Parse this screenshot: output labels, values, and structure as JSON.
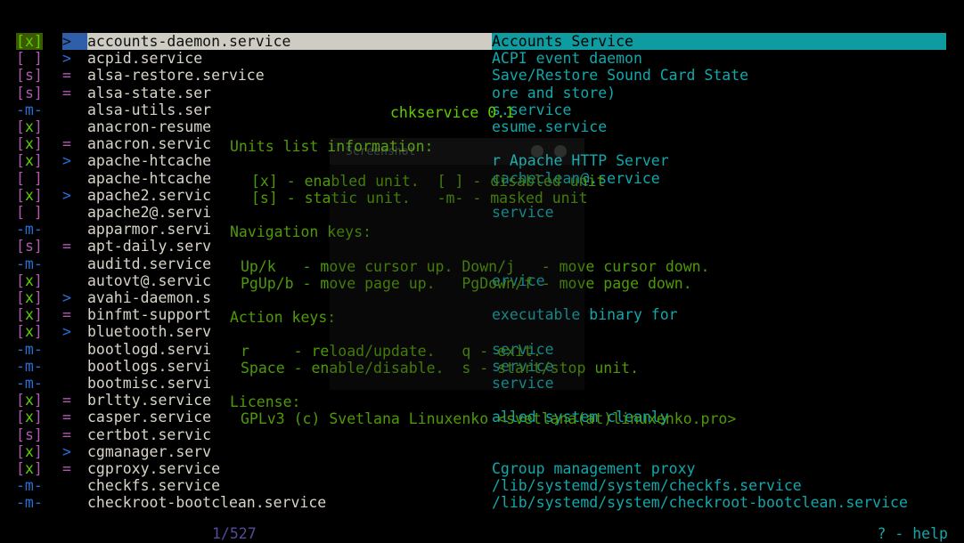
{
  "app": {
    "name": "chkservice",
    "version_line": "chkservice 0.1"
  },
  "colors": {
    "background": "#000000",
    "enabled": "#5fcc00",
    "disabled": "#b05ab0",
    "static": "#b05ab0",
    "masked": "#2a6fd6",
    "unit_name": "#d9d4c8",
    "description": "#11a8ab",
    "help_text": "#4e9a06",
    "selection_name_bg": "#cfcdc3",
    "selection_desc_bg": "#0e9ca0",
    "selection_link_bg": "#2f5fa8",
    "position_counter": "#5a4a9a"
  },
  "legend": {
    "enabled": "[x]",
    "disabled": "[ ]",
    "static": "[s]",
    "masked": "-m-",
    "link_wants": ">",
    "link_requires": "="
  },
  "help_panel": {
    "version": "chkservice 0.1",
    "section_units_title": "Units list information:",
    "units_line_1": "[x] - enabled unit.  [ ] - disabled unit",
    "units_line_2": "[s] - static unit.   -m- - masked unit",
    "section_nav_title": "Navigation keys:",
    "nav_line_1": "Up/k   - move cursor up. Down/j   - move cursor down.",
    "nav_line_2": "PgUp/b - move page up.   PgDown/f - move page down.",
    "section_action_title": "Action keys:",
    "action_line_1": "r     - reload/update.   q - exit.",
    "action_line_2": "Space - enable/disable.  s - start/stop unit.",
    "section_license_title": "License:",
    "license_line": "GPLv3 (c) Svetlana Linuxenko <svetlana(at)linuxenko.pro>"
  },
  "ghost_window": {
    "title": "Screenshot",
    "minimize_label": "−",
    "close_label": "✕"
  },
  "status_bar": {
    "position": "1/527",
    "help_hint": "? - help"
  },
  "units": [
    {
      "flag": "[x]",
      "state": "enabled",
      "link": ">",
      "name": "accounts-daemon.service",
      "description": "Accounts Service",
      "selected": true
    },
    {
      "flag": "[ ]",
      "state": "disabled",
      "link": ">",
      "name": "acpid.service",
      "description": "ACPI event daemon",
      "selected": false
    },
    {
      "flag": "[s]",
      "state": "static",
      "link": "=",
      "name": "alsa-restore.service",
      "description": "Save/Restore Sound Card State",
      "selected": false
    },
    {
      "flag": "[s]",
      "state": "static",
      "link": "=",
      "name": "alsa-state.ser",
      "description": "ore and store)",
      "selected": false
    },
    {
      "flag": "-m-",
      "state": "masked",
      "link": "",
      "name": "alsa-utils.ser",
      "description": "s.service",
      "selected": false
    },
    {
      "flag": "[x]",
      "state": "enabled",
      "link": "",
      "name": "anacron-resume",
      "description": "esume.service",
      "selected": false
    },
    {
      "flag": "[x]",
      "state": "enabled",
      "link": "=",
      "name": "anacron.servic",
      "description": "",
      "selected": false
    },
    {
      "flag": "[x]",
      "state": "enabled",
      "link": ">",
      "name": "apache-htcache",
      "description": "r Apache HTTP Server",
      "selected": false
    },
    {
      "flag": "[ ]",
      "state": "disabled",
      "link": "",
      "name": "apache-htcache",
      "description": "cacheclean@.service",
      "selected": false
    },
    {
      "flag": "[x]",
      "state": "enabled",
      "link": ">",
      "name": "apache2.servic",
      "description": "",
      "selected": false
    },
    {
      "flag": "[ ]",
      "state": "disabled",
      "link": "",
      "name": "apache2@.servi",
      "description": "service",
      "selected": false
    },
    {
      "flag": "-m-",
      "state": "masked",
      "link": "",
      "name": "apparmor.servi",
      "description": "",
      "selected": false
    },
    {
      "flag": "[s]",
      "state": "static",
      "link": "=",
      "name": "apt-daily.serv",
      "description": "",
      "selected": false
    },
    {
      "flag": "-m-",
      "state": "masked",
      "link": "",
      "name": "auditd.service",
      "description": "",
      "selected": false
    },
    {
      "flag": "[x]",
      "state": "enabled",
      "link": "",
      "name": "autovt@.servic",
      "description": "ervice",
      "selected": false
    },
    {
      "flag": "[x]",
      "state": "enabled",
      "link": ">",
      "name": "avahi-daemon.s",
      "description": "",
      "selected": false
    },
    {
      "flag": "[x]",
      "state": "enabled",
      "link": "=",
      "name": "binfmt-support",
      "description": "executable binary for",
      "selected": false
    },
    {
      "flag": "[x]",
      "state": "enabled",
      "link": ">",
      "name": "bluetooth.serv",
      "description": "",
      "selected": false
    },
    {
      "flag": "-m-",
      "state": "masked",
      "link": "",
      "name": "bootlogd.servi",
      "description": "service",
      "selected": false
    },
    {
      "flag": "-m-",
      "state": "masked",
      "link": "",
      "name": "bootlogs.servi",
      "description": "service",
      "selected": false
    },
    {
      "flag": "-m-",
      "state": "masked",
      "link": "",
      "name": "bootmisc.servi",
      "description": "service",
      "selected": false
    },
    {
      "flag": "[x]",
      "state": "enabled",
      "link": "=",
      "name": "brltty.service",
      "description": "",
      "selected": false
    },
    {
      "flag": "[x]",
      "state": "enabled",
      "link": "=",
      "name": "casper.service",
      "description": "alled system cleanly",
      "selected": false
    },
    {
      "flag": "[s]",
      "state": "static",
      "link": "=",
      "name": "certbot.servic",
      "description": "",
      "selected": false
    },
    {
      "flag": "[x]",
      "state": "enabled",
      "link": ">",
      "name": "cgmanager.serv",
      "description": "",
      "selected": false
    },
    {
      "flag": "[x]",
      "state": "enabled",
      "link": "=",
      "name": "cgproxy.service",
      "description": "Cgroup management proxy",
      "selected": false
    },
    {
      "flag": "-m-",
      "state": "masked",
      "link": "",
      "name": "checkfs.service",
      "description": "/lib/systemd/system/checkfs.service",
      "selected": false
    },
    {
      "flag": "-m-",
      "state": "masked",
      "link": "",
      "name": "checkroot-bootclean.service",
      "description": "/lib/systemd/system/checkroot-bootclean.service",
      "selected": false
    }
  ]
}
